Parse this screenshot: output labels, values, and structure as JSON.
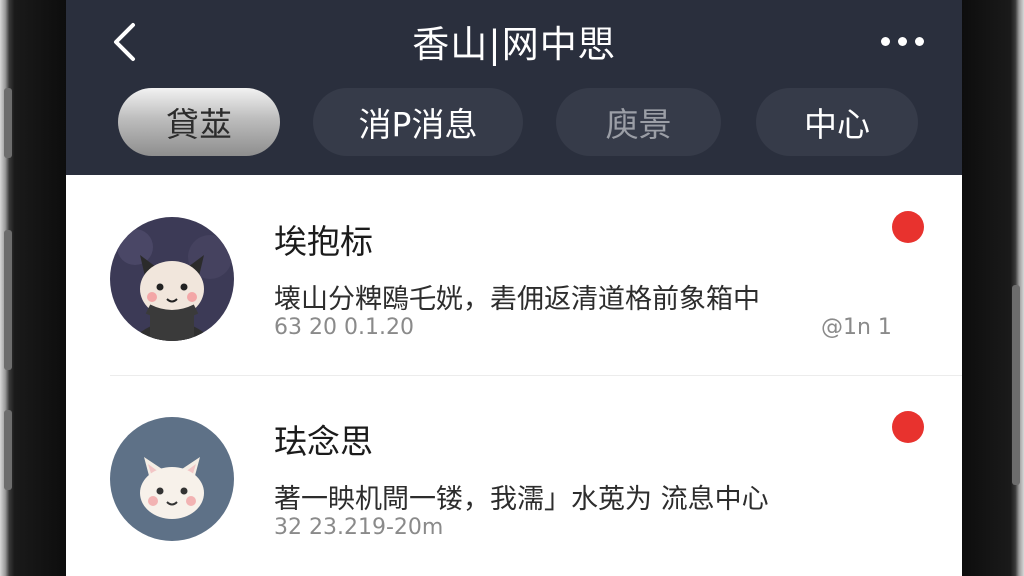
{
  "header": {
    "title": "香山|网中愳",
    "back_icon": "chevron-left-icon",
    "more_icon": "more-horizontal-icon"
  },
  "tabs": [
    {
      "label": "貸莁",
      "active": true
    },
    {
      "label": "消P消息",
      "active": false
    },
    {
      "label": "庾景",
      "active": false
    },
    {
      "label": "中心",
      "active": false
    }
  ],
  "messages": [
    {
      "name": "埃抱标",
      "preview": "壊山分粺鴎乇姯，砉佣返清道格前象箱中",
      "time": "63 20 0.1.20",
      "meta": "@1n  1",
      "unread": true,
      "avatar": "cat-avatar-dark"
    },
    {
      "name": "珐念思",
      "preview": "著一眏机閜一镂，我濡」水莵为 流息中心",
      "time": "32 23.219-20m",
      "meta": "",
      "unread": true,
      "avatar": "cat-avatar-light"
    }
  ],
  "colors": {
    "header_bg": "#2a2f3d",
    "unread": "#e8322e",
    "active_tab": "#bdbdbd"
  }
}
